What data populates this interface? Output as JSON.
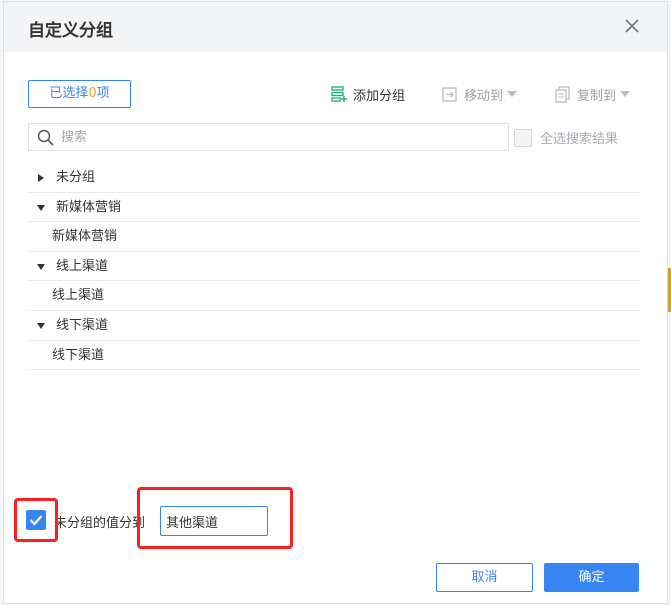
{
  "dialog": {
    "title": "自定义分组"
  },
  "toolbar": {
    "selected_prefix": "已选择",
    "selected_count": "0",
    "selected_suffix": "项",
    "add_group": "添加分组",
    "move_to": "移动到",
    "copy_to": "复制到"
  },
  "search": {
    "placeholder": "搜索",
    "select_all_label": "全选搜索结果"
  },
  "tree": {
    "ungrouped": "未分组",
    "groups": [
      {
        "name": "新媒体营销",
        "children": [
          "新媒体营销"
        ]
      },
      {
        "name": "线上渠道",
        "children": [
          "线上渠道"
        ]
      },
      {
        "name": "线下渠道",
        "children": [
          "线下渠道"
        ]
      }
    ]
  },
  "footer": {
    "ungrouped_to_label": "未分组的值分到",
    "ungrouped_to_value": "其他渠道",
    "cancel": "取消",
    "confirm": "确定"
  },
  "colors": {
    "accent": "#3685f2",
    "highlight": "#ff1d1d",
    "count": "#f5a623"
  }
}
